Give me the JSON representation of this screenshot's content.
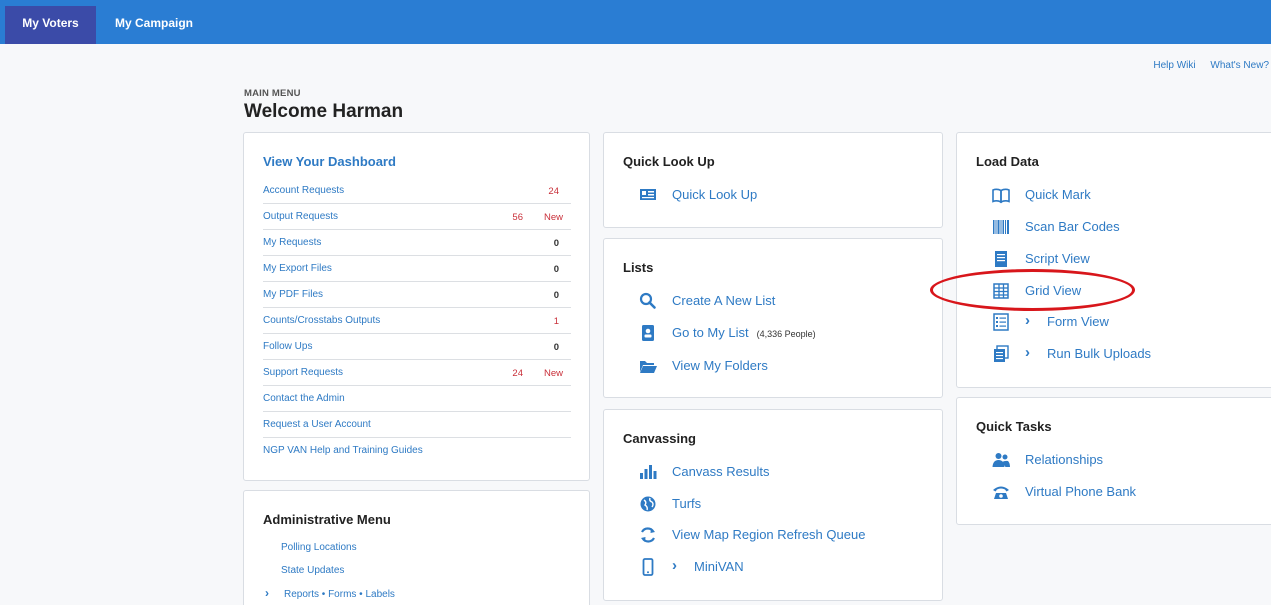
{
  "nav": {
    "tabs": [
      {
        "label": "My Voters",
        "active": true
      },
      {
        "label": "My Campaign",
        "active": false
      }
    ]
  },
  "top_links": {
    "help": "Help Wiki",
    "whats_new": "What's New?"
  },
  "header": {
    "section": "MAIN MENU",
    "title": "Welcome Harman"
  },
  "dashboard": {
    "title": "View Your Dashboard",
    "rows": [
      {
        "label": "Account Requests",
        "count": "24",
        "new": ""
      },
      {
        "label": "Output Requests",
        "count": "56",
        "new": "New"
      },
      {
        "label": "My Requests",
        "count": "0",
        "new": ""
      },
      {
        "label": "My Export Files",
        "count": "0",
        "new": ""
      },
      {
        "label": "My PDF Files",
        "count": "0",
        "new": ""
      },
      {
        "label": "Counts/Crosstabs Outputs",
        "count": "1",
        "new": ""
      },
      {
        "label": "Follow Ups",
        "count": "0",
        "new": ""
      },
      {
        "label": "Support Requests",
        "count": "24",
        "new": "New"
      },
      {
        "label": "Contact the Admin",
        "count": "",
        "new": ""
      },
      {
        "label": "Request a User Account",
        "count": "",
        "new": ""
      },
      {
        "label": "NGP VAN Help and Training Guides",
        "count": "",
        "new": ""
      }
    ]
  },
  "admin": {
    "title": "Administrative Menu",
    "items": [
      "Polling Locations",
      "State Updates",
      "Reports • Forms • Labels"
    ]
  },
  "quick_lookup": {
    "title": "Quick Look Up",
    "items": [
      {
        "label": "Quick Look Up",
        "icon": "id-card-icon"
      }
    ]
  },
  "lists": {
    "title": "Lists",
    "items": [
      {
        "label": "Create A New List",
        "icon": "search-icon"
      },
      {
        "label": "Go to My List",
        "icon": "id-badge-icon",
        "note": "(4,336 People)"
      },
      {
        "label": "View My Folders",
        "icon": "folder-open-icon"
      }
    ]
  },
  "canvassing": {
    "title": "Canvassing",
    "items": [
      {
        "label": "Canvass Results",
        "icon": "bar-chart-icon"
      },
      {
        "label": "Turfs",
        "icon": "globe-icon"
      },
      {
        "label": "View Map Region Refresh Queue",
        "icon": "refresh-icon"
      },
      {
        "label": "MiniVAN",
        "icon": "mobile-phone-icon"
      }
    ]
  },
  "load_data": {
    "title": "Load Data",
    "items": [
      {
        "label": "Quick Mark",
        "icon": "open-book-icon"
      },
      {
        "label": "Scan Bar Codes",
        "icon": "barcode-icon"
      },
      {
        "label": "Script View",
        "icon": "document-icon"
      },
      {
        "label": "Grid View",
        "icon": "grid-table-icon"
      },
      {
        "label": "Form View",
        "icon": "form-list-icon"
      },
      {
        "label": "Run Bulk Uploads",
        "icon": "bulk-upload-icon"
      }
    ]
  },
  "quick_tasks": {
    "title": "Quick Tasks",
    "items": [
      {
        "label": "Relationships",
        "icon": "people-icon"
      },
      {
        "label": "Virtual Phone Bank",
        "icon": "telephone-icon"
      }
    ]
  },
  "colors": {
    "topbar": "#2a7dd3",
    "active_tab": "#3b4ba8",
    "link": "#2e7ac4",
    "alert": "#c9303a",
    "annotation": "#d8161b"
  }
}
